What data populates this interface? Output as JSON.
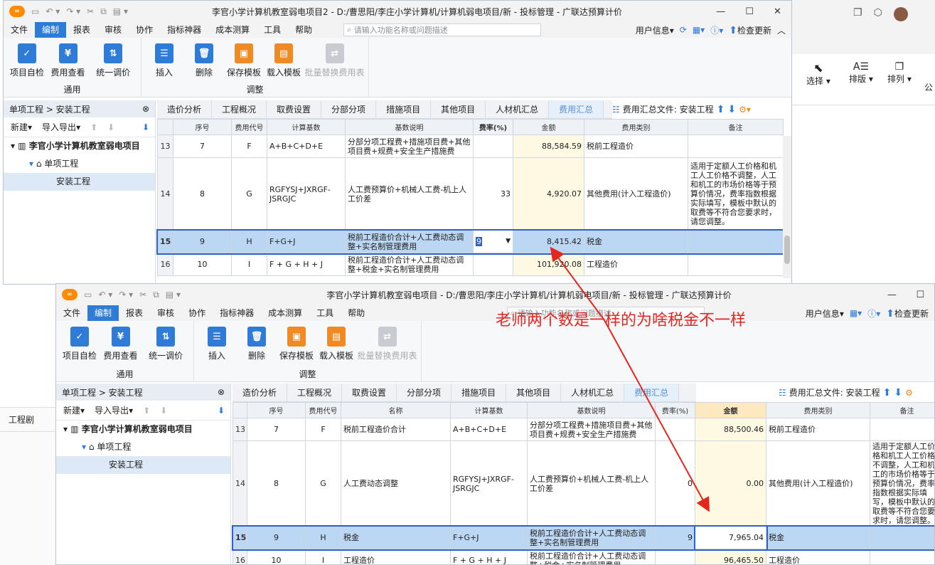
{
  "win1": {
    "title": "李官小学计算机教室弱电项目2 - D:/曹思阳/李庄小学计算机/计算机弱电项目/新 - 投标管理 - 广联达预算计价",
    "menu": [
      "文件",
      "编制",
      "报表",
      "审核",
      "协作",
      "指标神器",
      "成本测算",
      "工具",
      "帮助"
    ],
    "search_placeholder": "请输入功能名称或问题描述",
    "right": {
      "user": "用户信息",
      "update": "检查更新"
    },
    "ribbon": {
      "buttons": [
        "项目自检",
        "费用查看",
        "统一调价",
        "插入",
        "删除",
        "保存模板",
        "载入模板",
        "批量替换费用表"
      ],
      "group_general": "通用",
      "group_adjust": "调整"
    },
    "breadcrumb": "单项工程 > 安装工程",
    "toolbar": {
      "new": "新建",
      "import": "导入导出"
    },
    "tree": {
      "project": "李官小学计算机教室弱电项目",
      "unit": "单项工程",
      "install": "安装工程"
    },
    "tabs": [
      "造价分析",
      "工程概况",
      "取费设置",
      "分部分项",
      "措施项目",
      "其他项目",
      "人材机汇总",
      "费用汇总"
    ],
    "file_label": "费用汇总文件: 安装工程",
    "headers": [
      "序号",
      "费用代号",
      "计算基数",
      "基数说明",
      "费率(%)",
      "金额",
      "费用类别",
      "备注"
    ],
    "rows": [
      {
        "rn": "13",
        "seq": "7",
        "code": "F",
        "base": "A+B+C+D+E",
        "desc": "分部分项工程费+措施项目费+其他项目费+规费+安全生产措施费",
        "rate": "",
        "amount": "88,584.59",
        "cat": "税前工程造价",
        "note": ""
      },
      {
        "rn": "14",
        "seq": "8",
        "code": "G",
        "base": "RGFYSJ+JXRGF-JSRGJC",
        "desc": "人工费预算价+机械人工费-机上人工价差",
        "rate": "33",
        "amount": "4,920.07",
        "cat": "其他费用(计入工程造价)",
        "note": "适用于定额人工价格和机工人工价格不调整，人工和机工的市场价格等于预算价情况，费率指数根据实际填写，模板中默认的取费等不符合您要求时，请您调整。"
      },
      {
        "rn": "15",
        "seq": "9",
        "code": "H",
        "base": "F+G+J",
        "desc": "税前工程造价合计+人工费动态调整+实名制管理费用",
        "rate": "9",
        "amount": "8,415.42",
        "cat": "税金",
        "note": ""
      },
      {
        "rn": "16",
        "seq": "10",
        "code": "I",
        "base": "F + G + H + J",
        "desc": "税前工程造价合计+人工费动态调整+税金+实名制管理费用",
        "rate": "",
        "amount": "101,920.08",
        "cat": "工程造价",
        "note": ""
      }
    ]
  },
  "win2": {
    "title": "李官小学计算机教室弱电项目 - D:/曹思阳/李庄小学计算机/计算机弱电项目/新 - 投标管理 - 广联达预算计价",
    "menu": [
      "文件",
      "编制",
      "报表",
      "审核",
      "协作",
      "指标神器",
      "成本测算",
      "工具",
      "帮助"
    ],
    "search_placeholder": "请输入功能名称或问题描述",
    "right": {
      "user": "用户信息",
      "update": "检查更新"
    },
    "ribbon": {
      "buttons": [
        "项目自检",
        "费用查看",
        "统一调价",
        "插入",
        "删除",
        "保存模板",
        "载入模板",
        "批量替换费用表"
      ],
      "group_general": "通用",
      "group_adjust": "调整"
    },
    "breadcrumb": "单项工程 > 安装工程",
    "toolbar": {
      "new": "新建",
      "import": "导入导出"
    },
    "tree": {
      "project": "李官小学计算机教室弱电项目",
      "unit": "单项工程",
      "install": "安装工程"
    },
    "tabs": [
      "造价分析",
      "工程概况",
      "取费设置",
      "分部分项",
      "措施项目",
      "其他项目",
      "人材机汇总",
      "费用汇总"
    ],
    "file_label": "费用汇总文件: 安装工程",
    "headers": [
      "序号",
      "费用代号",
      "名称",
      "计算基数",
      "基数说明",
      "费率(%)",
      "金额",
      "费用类别",
      "备注"
    ],
    "rows": [
      {
        "rn": "13",
        "seq": "7",
        "code": "F",
        "name": "税前工程造价合计",
        "base": "A+B+C+D+E",
        "desc": "分部分项工程费+措施项目费+其他项目费+规费+安全生产措施费",
        "rate": "",
        "amount": "88,500.46",
        "cat": "税前工程造价",
        "note": ""
      },
      {
        "rn": "14",
        "seq": "8",
        "code": "G",
        "name": "人工费动态调整",
        "base": "RGFYSJ+JXRGF-JSRGJC",
        "desc": "人工费预算价+机械人工费-机上人工价差",
        "rate": "0",
        "amount": "0.00",
        "cat": "其他费用(计入工程造价)",
        "note": "适用于定额人工价格和机工人工价格不调整，人工和机工的市场价格等于预算价情况，费率指数根据实际填写，模板中默认的取费等不符合您要求时，请您调整。"
      },
      {
        "rn": "15",
        "seq": "9",
        "code": "H",
        "name": "税金",
        "base": "F+G+J",
        "desc": "税前工程造价合计+人工费动态调整+实名制管理费用",
        "rate": "9",
        "amount": "7,965.04",
        "cat": "税金",
        "note": ""
      },
      {
        "rn": "16",
        "seq": "10",
        "code": "I",
        "name": "工程造价",
        "base": "F + G + H + J",
        "desc": "税前工程造价合计+人工费动态调整+税金+实名制管理费用",
        "rate": "",
        "amount": "96,465.50",
        "cat": "工程造价",
        "note": ""
      }
    ]
  },
  "bg": {
    "select": "选择",
    "layout": "排版",
    "arrange": "排列",
    "pub": "公",
    "side_label": "工程剧"
  },
  "annotation": "老师两个数是一样的为啥税金不一样"
}
